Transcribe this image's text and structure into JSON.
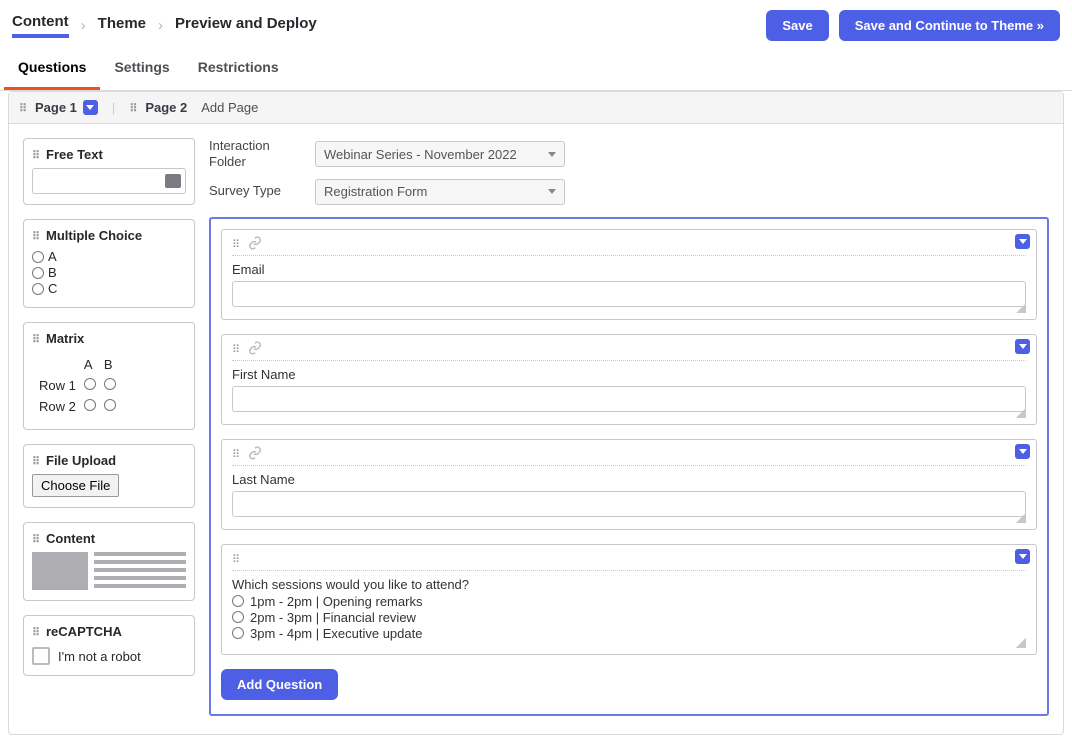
{
  "breadcrumb": [
    "Content",
    "Theme",
    "Preview and Deploy"
  ],
  "buttons": {
    "save": "Save",
    "save_continue": "Save and Continue to Theme »"
  },
  "tabs": {
    "questions": "Questions",
    "settings": "Settings",
    "restrictions": "Restrictions"
  },
  "pages": {
    "p1": "Page 1",
    "p2": "Page 2",
    "add": "Add Page"
  },
  "sidebar": {
    "free_text": "Free Text",
    "multiple_choice": "Multiple Choice",
    "mc_options": [
      "A",
      "B",
      "C"
    ],
    "matrix": "Matrix",
    "matrix_cols": [
      "A",
      "B"
    ],
    "matrix_rows": [
      "Row 1",
      "Row 2"
    ],
    "file_upload": "File Upload",
    "choose_file": "Choose File",
    "content": "Content",
    "recaptcha": "reCAPTCHA",
    "recaptcha_label": "I'm not a robot"
  },
  "props": {
    "folder_label": "Interaction Folder",
    "folder_value": "Webinar Series - November 2022",
    "type_label": "Survey Type",
    "type_value": "Registration Form"
  },
  "questions": [
    {
      "label": "Email"
    },
    {
      "label": "First Name"
    },
    {
      "label": "Last Name"
    }
  ],
  "mcq": {
    "prompt": "Which sessions would you like to attend?",
    "options": [
      "1pm - 2pm | Opening remarks",
      "2pm - 3pm | Financial review",
      "3pm - 4pm | Executive update"
    ]
  },
  "add_question": "Add Question"
}
